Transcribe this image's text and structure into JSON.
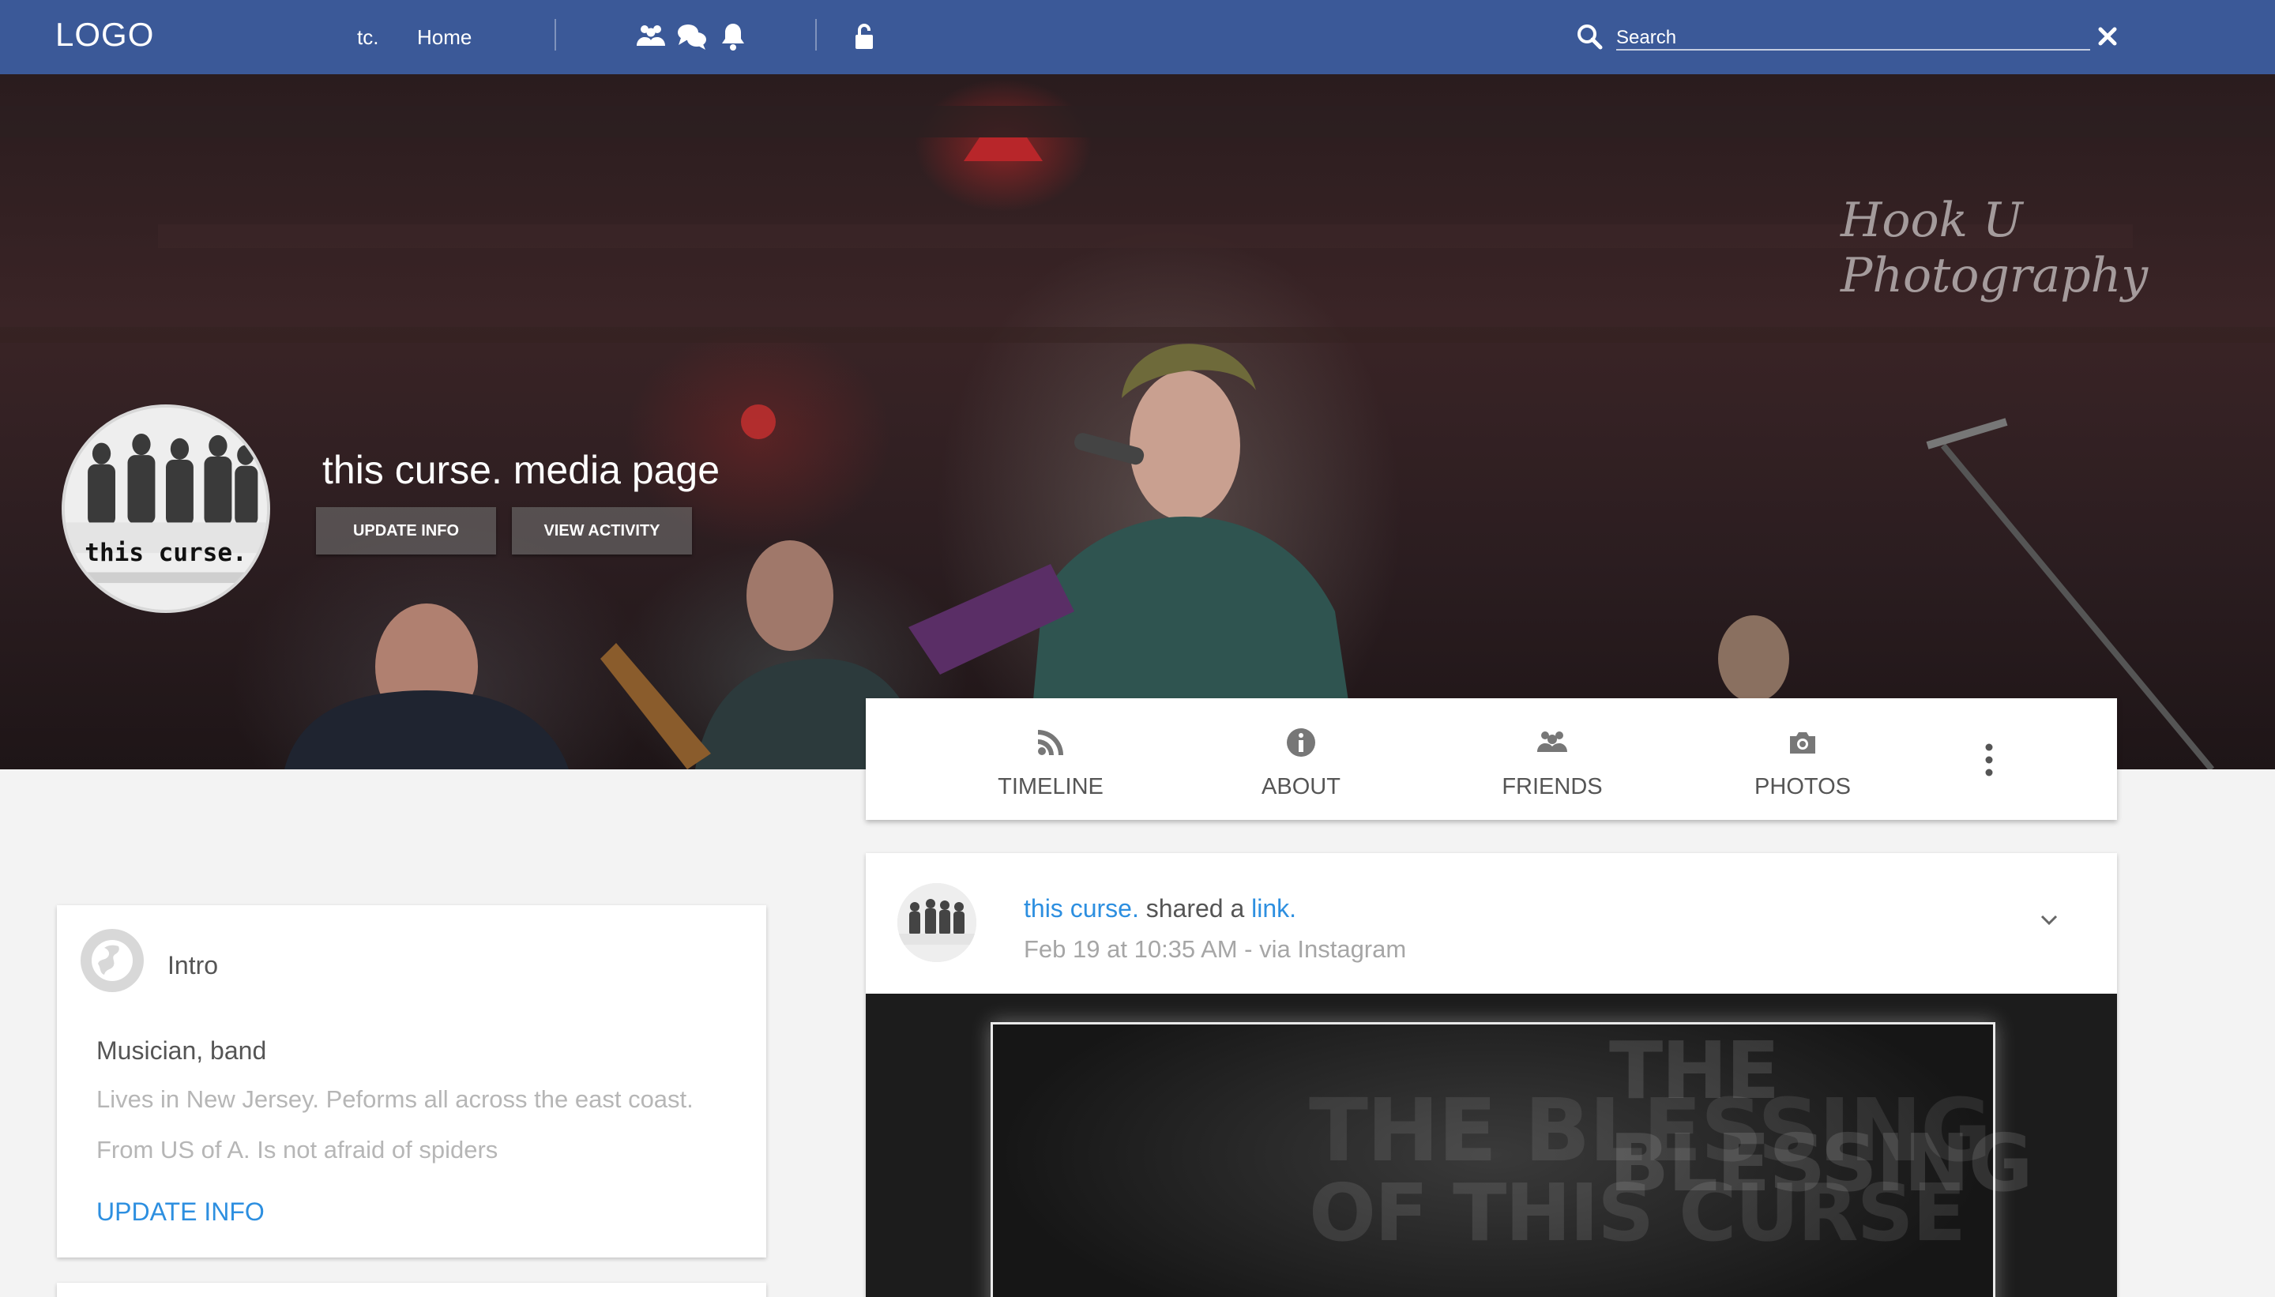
{
  "navbar": {
    "logo": "LOGO",
    "links": [
      {
        "label": "tc."
      },
      {
        "label": "Home"
      }
    ],
    "icons": [
      "friends-icon",
      "messages-icon",
      "notifications-icon",
      "lock-icon"
    ],
    "search_placeholder": "Search",
    "background": "#3b5998"
  },
  "cover": {
    "watermark": "Hook U Photography",
    "page_title": "this curse. media page",
    "avatar_caption": "this curse.",
    "buttons": {
      "update_info": "UPDATE INFO",
      "view_activity": "VIEW ACTIVITY"
    }
  },
  "tabs": [
    {
      "label": "TIMELINE",
      "icon": "rss-icon"
    },
    {
      "label": "ABOUT",
      "icon": "info-icon"
    },
    {
      "label": "FRIENDS",
      "icon": "friends-icon"
    },
    {
      "label": "PHOTOS",
      "icon": "camera-icon"
    }
  ],
  "intro": {
    "title": "Intro",
    "role": "Musician, band",
    "lines": [
      "Lives in New Jersey. Peforms all across the east coast.",
      "From US of A. Is not afraid of spiders"
    ],
    "action": "UPDATE INFO"
  },
  "post": {
    "author": "this curse.",
    "verb": " shared a ",
    "object": "link.",
    "meta": "Feb 19 at 10:35 AM - via Instagram",
    "media_text": [
      "THE BLESSING",
      "OF THIS CURSE"
    ]
  },
  "colors": {
    "link": "#2d8fe0",
    "tab_text": "#555555",
    "muted": "#b6b6b6"
  }
}
